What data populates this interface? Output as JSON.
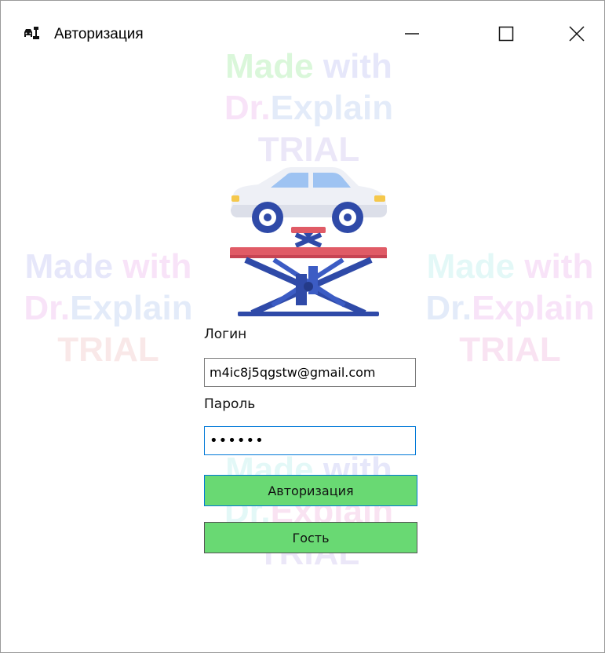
{
  "window": {
    "title": "Авторизация",
    "app_icon": "car-repair-tools-icon",
    "controls": [
      "minimize-icon",
      "maximize-icon",
      "close-icon"
    ]
  },
  "watermark": {
    "line1a": "Made",
    "line1b": "with",
    "line2a": "Dr.",
    "line2b": "Explain",
    "line3": "TRIAL"
  },
  "logo": {
    "icon": "car-lift-icon"
  },
  "form": {
    "login_label": "Логин",
    "login_value": "m4ic8j5qgstw@gmail.com",
    "password_label": "Пароль",
    "password_value": "••••••",
    "auth_button": "Авторизация",
    "guest_button": "Гость"
  },
  "colors": {
    "button_green": "#69d973",
    "focus_blue": "#0078d7"
  }
}
